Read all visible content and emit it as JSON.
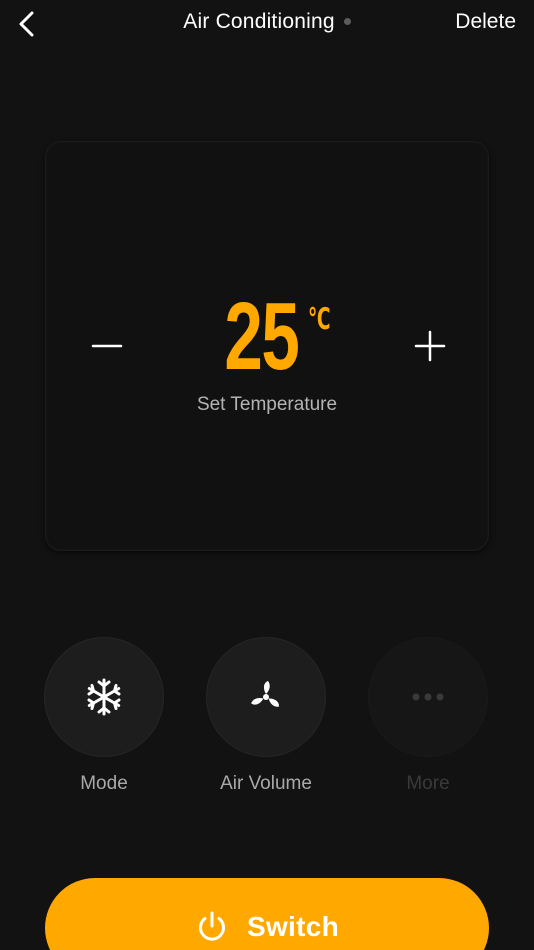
{
  "header": {
    "title": "Air Conditioning",
    "delete_label": "Delete",
    "back_icon": "chevron-left-icon",
    "status_color": "#5c5c5c"
  },
  "temperature": {
    "value": "25",
    "unit": "℃",
    "label": "Set Temperature",
    "decrease_icon": "minus-icon",
    "increase_icon": "plus-icon",
    "accent_color": "#FFA800"
  },
  "controls": [
    {
      "label": "Mode",
      "icon": "snowflake-icon",
      "enabled": true
    },
    {
      "label": "Air Volume",
      "icon": "fan-icon",
      "enabled": true
    },
    {
      "label": "More",
      "icon": "more-dots-icon",
      "enabled": false
    }
  ],
  "switch": {
    "label": "Switch",
    "icon": "power-icon",
    "color": "#FFA800"
  }
}
